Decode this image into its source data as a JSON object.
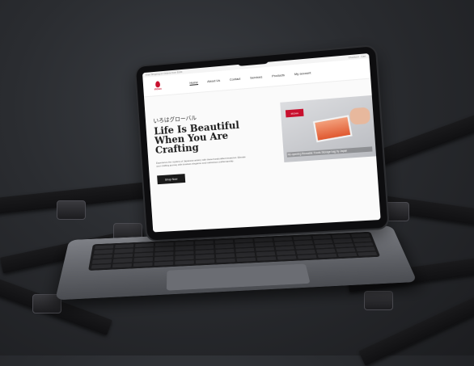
{
  "site": {
    "topbar_left": "Free Shipping on Orders Over $100",
    "topbar_right": "Checkout · Cart",
    "logo_text": "IROHA",
    "nav": [
      "Home",
      "About Us",
      "Contact",
      "Services",
      "Products",
      "My account"
    ],
    "jp_heading": "いろはグローバル",
    "headline": "Life Is Beautiful When You Are Crafting",
    "description": "Experience the mystery of Japanese artistry with these handcrafted treasures. Elevate your crafting journey with timeless elegance and meticulous craftsmanship.",
    "cta": "Shop Now",
    "video_label": "IROHA",
    "video_caption": "Re-opening Reusable Foods Storage bag by Japan"
  },
  "colors": {
    "accent": "#c8102e",
    "dark": "#1a1a1a",
    "background": "#2a2c30"
  }
}
